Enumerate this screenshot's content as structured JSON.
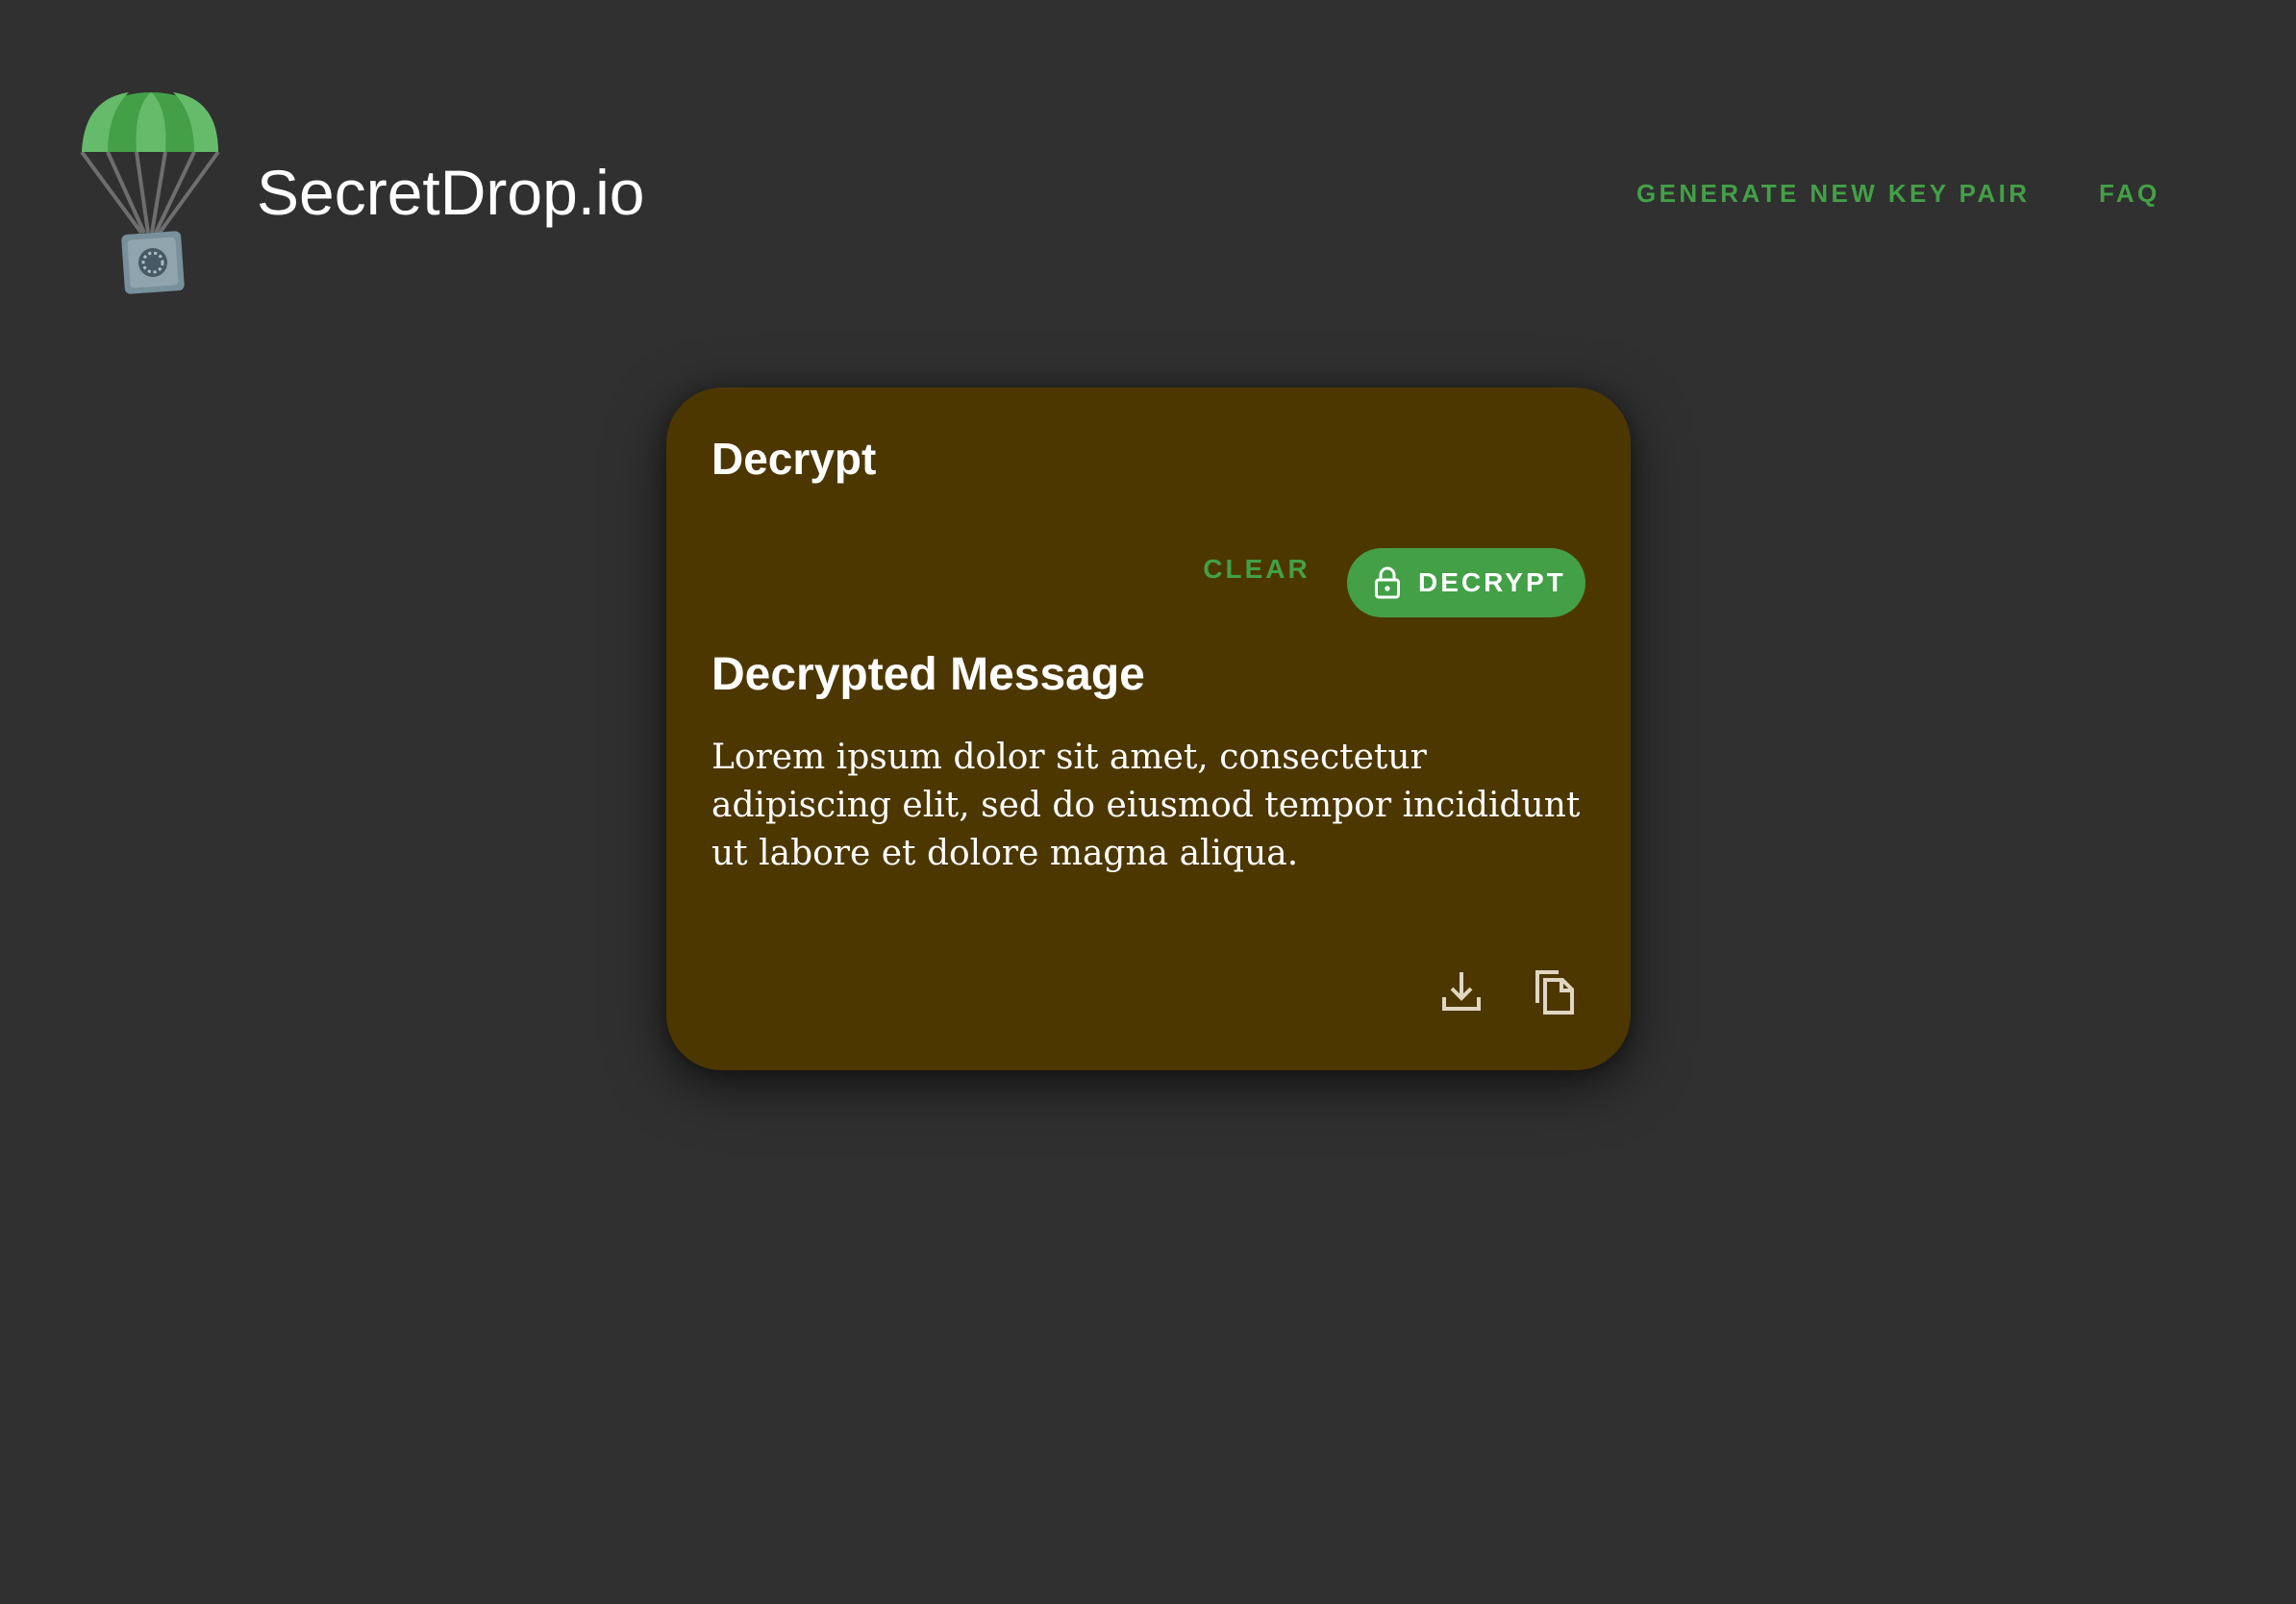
{
  "header": {
    "brand_name": "SecretDrop.io",
    "nav": {
      "generate_label": "GENERATE NEW KEY PAIR",
      "faq_label": "FAQ"
    }
  },
  "card": {
    "title": "Decrypt",
    "clear_label": "CLEAR",
    "decrypt_label": "DECRYPT",
    "decrypted_title": "Decrypted Message",
    "message": "Lorem ipsum dolor sit amet, consectetur adipiscing elit, sed do eiusmod tempor incididunt ut labore et dolore magna aliqua."
  },
  "icons": {
    "logo": "parachute-safe-logo-icon",
    "decrypt": "lock-icon",
    "download": "download-icon",
    "copy": "copy-icon"
  },
  "colors": {
    "background": "#303030",
    "card": "#4d3700",
    "accent": "#43a047",
    "text": "#ffffff"
  }
}
